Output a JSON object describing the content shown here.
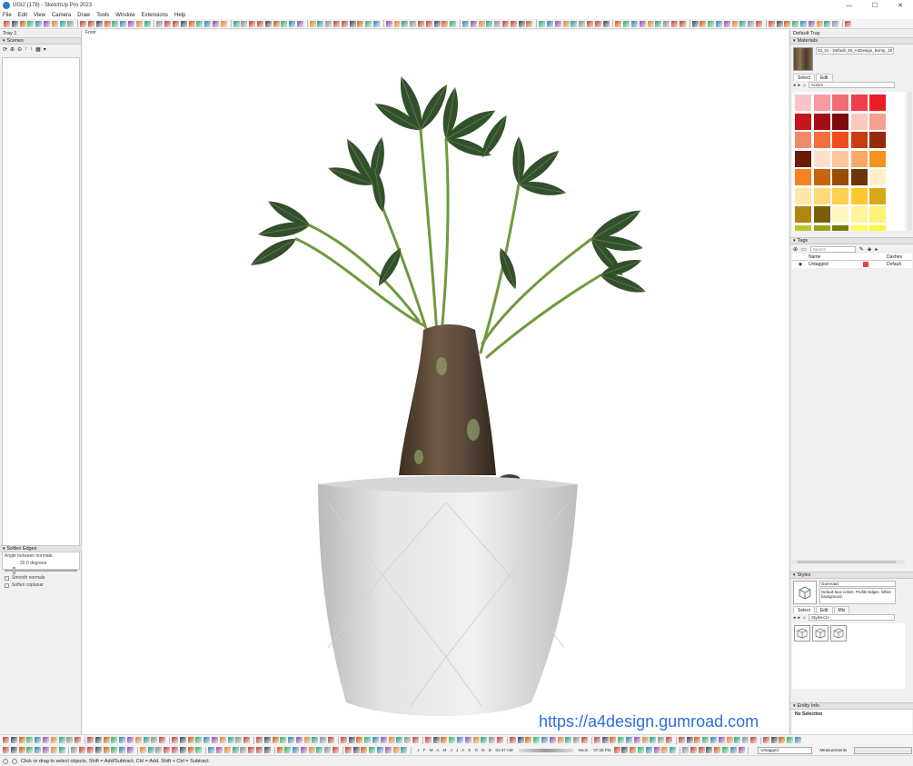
{
  "window": {
    "title": "UGI2 (178) - SketchUp Pro 2023",
    "controls": [
      "—",
      "☐",
      "✕"
    ]
  },
  "menu": [
    "File",
    "Edit",
    "View",
    "Camera",
    "Draw",
    "Tools",
    "Window",
    "Extensions",
    "Help"
  ],
  "left_tray": {
    "title": "Tray 1",
    "scenes_label": "Scenes",
    "soften_label": "Soften Edges",
    "angle_label": "Angle between normals:",
    "angle_value": "20.0  degrees",
    "smooth_normals": "Smooth normals",
    "soften_coplanar": "Soften coplanar",
    "angle_slider_fraction": 0.11
  },
  "viewport": {
    "view_label": "Front",
    "watermark": "https://a4design.gumroad.com"
  },
  "right_tray": {
    "title": "Default Tray",
    "materials": {
      "label": "Materials",
      "material_name": "03_01 - Default_60_A4Design_Bump_19",
      "tab_select": "Select",
      "tab_edit": "Edit",
      "library": "Colors",
      "swatch_colors": [
        "#fbc3c8",
        "#f79aa2",
        "#f26b76",
        "#f03d4c",
        "#ee1c24",
        "#c4151c",
        "#a30d16",
        "#7f0a10",
        "#f9c9bd",
        "#f6a08d",
        "#f28a6a",
        "#f46f3c",
        "#f04e1f",
        "#c83e12",
        "#942c0c",
        "#6b1c07",
        "#fde0c9",
        "#fbc69c",
        "#f9a866",
        "#f6921e",
        "#f58220",
        "#c9650f",
        "#9b4c0b",
        "#6d3508",
        "#fff0c9",
        "#fde7a6",
        "#fdd978",
        "#fdd14e",
        "#fdc82f",
        "#d9a617",
        "#b08510",
        "#7c5d0b",
        "#fff7c1",
        "#fff49a",
        "#fff275",
        "#c3c22c",
        "#a0a016",
        "#7a7a0b",
        "#fdfd5b",
        "#fcf73a"
      ]
    },
    "tags": {
      "label": "Tags",
      "search_placeholder": "Search",
      "col_name": "Name",
      "col_dashes": "Dashes",
      "row_name": "Untagged",
      "row_color": "#e8434b",
      "row_dashes": "Default"
    },
    "styles": {
      "label": "Styles",
      "style_name": "Gumroad",
      "style_desc": "Default face colors. Profile Edges. White background.",
      "tab_select": "Select",
      "tab_edit": "Edit",
      "tab_mix": "Mix",
      "library": "Styles<1>"
    },
    "entity_info": {
      "label": "Entity Info",
      "selection": "No Selection"
    }
  },
  "bottom": {
    "months": "J F M A M J J A S O N D",
    "time_left": "04:37 AM",
    "noon": "Noon",
    "time_right": "07:28 PM",
    "tag_value": "Untagged",
    "measurements_label": "Measurements"
  },
  "status": {
    "text": "Click or drag to select objects. Shift = Add/Subtract. Ctrl = Add. Shift + Ctrl = Subtract."
  }
}
